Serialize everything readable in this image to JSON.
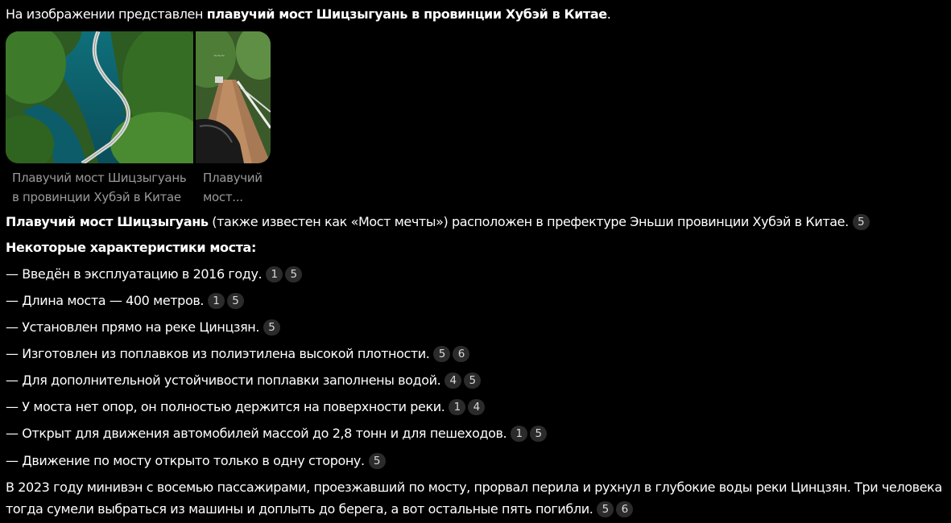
{
  "intro": {
    "prefix": "На изображении представлен ",
    "bold": "плавучий мост Шицзыгуань в провинции Хубэй в Китае",
    "suffix": "."
  },
  "gallery": {
    "items": [
      {
        "caption": "Плавучий мост Шицзыгуань в провинции Хубэй в Китае"
      },
      {
        "caption": "Плавучий мост..."
      }
    ]
  },
  "summary": {
    "bold": "Плавучий мост Шицзыгуань",
    "text": " (также известен как «Мост мечты») расположен в префектуре Эньши провинции Хубэй в Китае.",
    "refs": [
      "5"
    ]
  },
  "features": {
    "heading": "Некоторые характеристики моста:",
    "items": [
      {
        "dash": "—",
        "text": "Введён в эксплуатацию в 2016 году.",
        "refs": [
          "1",
          "5"
        ]
      },
      {
        "dash": "—",
        "text": "Длина моста — 400 метров.",
        "refs": [
          "1",
          "5"
        ]
      },
      {
        "dash": "—",
        "text": "Установлен прямо на реке Цинцзян.",
        "refs": [
          "5"
        ]
      },
      {
        "dash": "—",
        "text": "Изготовлен из поплавков из полиэтилена высокой плотности.",
        "refs": [
          "5",
          "6"
        ]
      },
      {
        "dash": "—",
        "text": "Для дополнительной устойчивости поплавки заполнены водой.",
        "refs": [
          "4",
          "5"
        ]
      },
      {
        "dash": "—",
        "text": "У моста нет опор, он полностью держится на поверхности реки.",
        "refs": [
          "1",
          "4"
        ]
      },
      {
        "dash": "—",
        "text": "Открыт для движения автомобилей массой до 2,8 тонн и для пешеходов.",
        "refs": [
          "1",
          "5"
        ]
      },
      {
        "dash": "—",
        "text": "Движение по мосту открыто только в одну сторону.",
        "refs": [
          "5"
        ]
      }
    ]
  },
  "incident": {
    "text": "В 2023 году минивэн с восемью пассажирами, проезжавший по мосту, прорвал перила и рухнул в глубокие воды реки Цинцзян. Три человека тогда сумели выбраться из машины и доплыть до берега, а вот остальные пять погибли.",
    "refs": [
      "5",
      "6"
    ]
  }
}
